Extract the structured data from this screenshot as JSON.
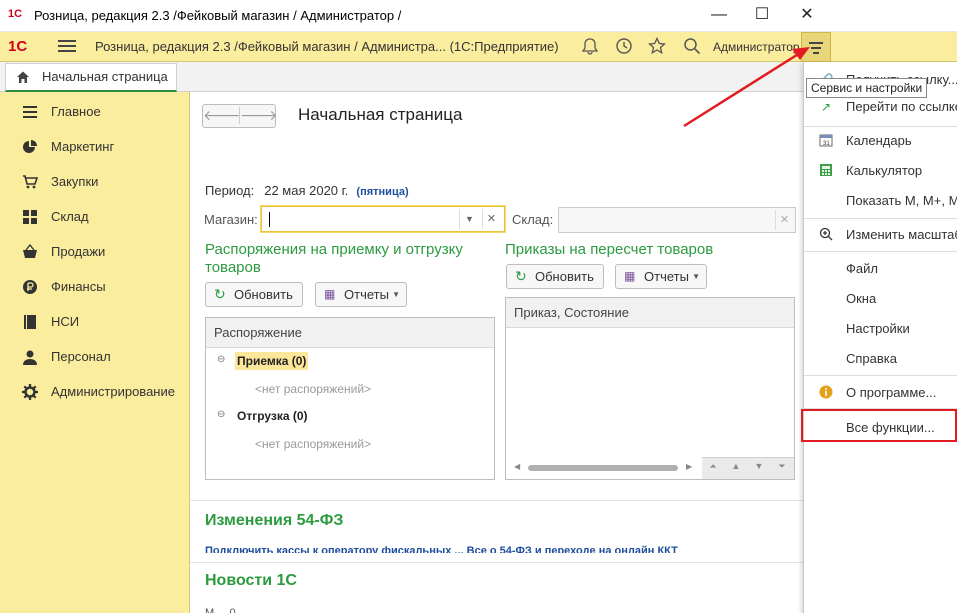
{
  "window": {
    "title": "Розница, редакция 2.3 /Фейковый магазин / Администратор /",
    "minimize": "—",
    "maximize": "☐",
    "close": "✕"
  },
  "topbar": {
    "logo": "1С",
    "app_title": "Розница, редакция 2.3 /Фейковый магазин / Администра...  (1С:Предприятие)",
    "user": "Администратор",
    "icons": [
      "bell-icon",
      "history-icon",
      "star-icon",
      "search-icon",
      "menu-icon"
    ]
  },
  "tabs": [
    {
      "label": "Начальная страница"
    }
  ],
  "sidebar": {
    "items": [
      {
        "label": "Главное",
        "icon": "list-icon"
      },
      {
        "label": "Маркетинг",
        "icon": "pie-icon"
      },
      {
        "label": "Закупки",
        "icon": "cart-icon"
      },
      {
        "label": "Склад",
        "icon": "grid-icon"
      },
      {
        "label": "Продажи",
        "icon": "basket-icon"
      },
      {
        "label": "Финансы",
        "icon": "coin-icon"
      },
      {
        "label": "НСИ",
        "icon": "book-icon"
      },
      {
        "label": "Персонал",
        "icon": "person-icon"
      },
      {
        "label": "Администрирование",
        "icon": "gear-icon"
      }
    ]
  },
  "main": {
    "page_title": "Начальная страница",
    "period_label": "Период:",
    "period_date": "22 мая 2020 г.",
    "period_day": "(пятница)",
    "shop_label": "Магазин:",
    "shop_value": "",
    "warehouse_label": "Склад:",
    "warehouse_value": "",
    "left_section_title_1": "Распоряжения на приемку и отгрузку",
    "left_section_title_2": "товаров",
    "right_section_title": "Приказы на пересчет товаров",
    "refresh_label": "Обновить",
    "reports_label": "Отчеты",
    "left_table_header": "Распоряжение",
    "tree": [
      {
        "label": "Приемка (0)",
        "empty": "<нет распоряжений>"
      },
      {
        "label": "Отгрузка (0)",
        "empty": "<нет распоряжений>"
      }
    ],
    "right_table_header": "Приказ, Состояние",
    "news1_title": "Изменения 54-ФЗ",
    "news1_text": "Подключить кассы к оператору фискальных ... Все о 54-ФЗ и переходе на онлайн ККТ",
    "news2_title": "Новости 1С",
    "news2_text": "М ... 0"
  },
  "dropdown": {
    "tooltip": "Сервис и настройки",
    "items": [
      {
        "label": "Получить ссылку...",
        "icon": "link-icon"
      },
      {
        "label": "Перейти по ссылке...",
        "icon": "goto-link-icon"
      },
      {
        "label": "Календарь",
        "icon": "calendar-icon"
      },
      {
        "label": "Калькулятор",
        "icon": "calculator-icon"
      },
      {
        "label": "Показать М, М+, М-",
        "icon": ""
      },
      {
        "label": "Изменить масштаб...",
        "icon": "zoom-icon"
      },
      {
        "label": "Файл",
        "icon": ""
      },
      {
        "label": "Окна",
        "icon": ""
      },
      {
        "label": "Настройки",
        "icon": ""
      },
      {
        "label": "Справка",
        "icon": ""
      },
      {
        "label": "О программе...",
        "icon": "info-icon"
      },
      {
        "label": "Все функции...",
        "icon": ""
      }
    ]
  },
  "colors": {
    "accent_yellow": "#fbed9e",
    "accent_green": "#2c9b3f",
    "highlight_red": "#e31b23"
  }
}
